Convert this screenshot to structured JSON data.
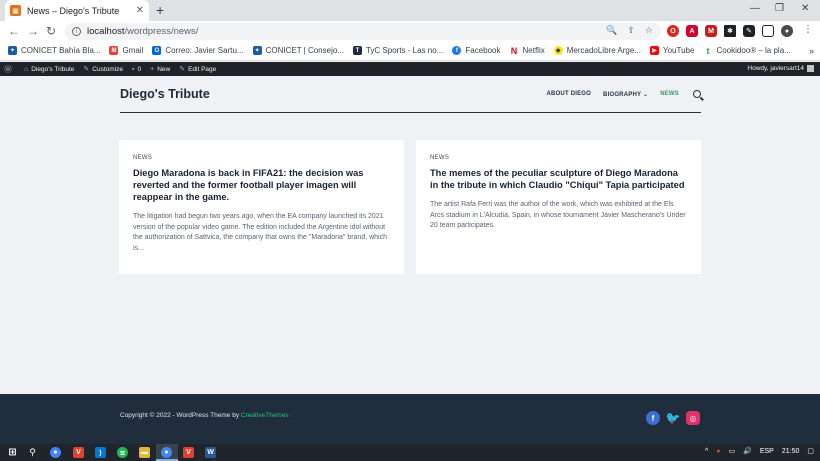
{
  "browser": {
    "tab_title": "News – Diego's Tribute",
    "url_host": "localhost",
    "url_path": "/wordpress/news/",
    "bookmarks": [
      "CONICET Bahía Bla...",
      "Gmail",
      "Correo: Javier Sartu...",
      "CONICET | Consejo...",
      "TyC Sports - Las no...",
      "Facebook",
      "Netflix",
      "MercadoLibre Arge...",
      "YouTube",
      "Cookidoo® – la pla..."
    ]
  },
  "adminbar": {
    "site": "Diego's Tribute",
    "customize": "Customize",
    "comments": "0",
    "new": "New",
    "edit": "Edit Page",
    "howdy": "Howdy, javiersart14"
  },
  "site": {
    "title": "Diego's Tribute",
    "nav": [
      "ABOUT DIEGO",
      "BIOGRAPHY",
      "NEWS"
    ]
  },
  "posts": [
    {
      "category": "NEWS",
      "title": "Diego Maradona is back in FIFA21: the decision was reverted and the former football player imagen will reappear in the game.",
      "excerpt": "The litigation had begun two years ago, when the EA company launched its 2021 version of the popular video game. The edition included the Argentine idol without the authorization of Sattvica, the company that owns the \"Maradona\" brand, which is..."
    },
    {
      "category": "NEWS",
      "title": "The memes of the peculiar sculpture of Diego Maradona in the tribute in which Claudio \"Chiqui\" Tapia participated",
      "excerpt": "The artist Rafa Ferri was the author of the work, which was exhibited at the Els Arcs stadium in L'Alcudia, Spain, in whose tournament Javier Mascherano's Under 20 team participates."
    }
  ],
  "footer": {
    "copyright": "Copyright © 2022 - WordPress Theme by ",
    "theme_link": "CreativeThemes"
  },
  "taskbar": {
    "lang": "ESP",
    "time": "21:50"
  },
  "colors": {
    "accent": "#2a9d5c",
    "footer_bg": "#1f2d3d",
    "adminbar_bg": "#1d2327"
  }
}
